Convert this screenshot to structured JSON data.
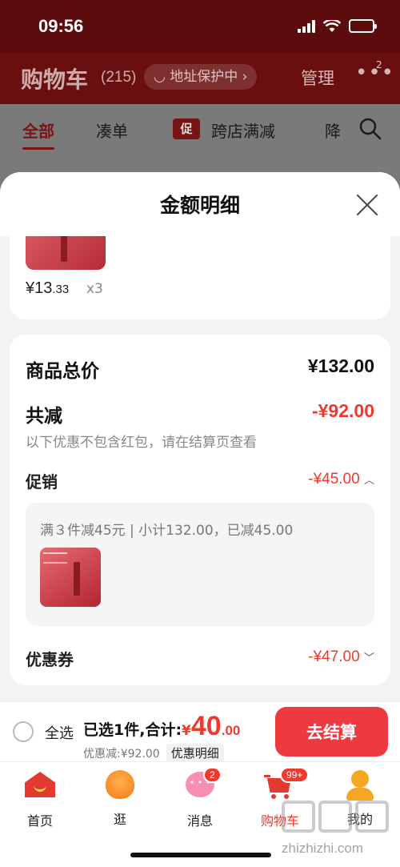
{
  "status": {
    "time": "09:56"
  },
  "header": {
    "title": "购物车",
    "count": "(215)",
    "address_protect": "地址保护中",
    "manage": "管理",
    "more_badge": "2"
  },
  "filters": {
    "all": "全部",
    "bundle": "凑单",
    "promo_tag": "促",
    "cross_store": "跨店满减",
    "cut_off": "降"
  },
  "sheet": {
    "title": "金额明细",
    "item_price_main": "¥13",
    "item_price_decimal": ".33",
    "item_qty": "x3",
    "total_label": "商品总价",
    "total_value": "¥132.00",
    "reduce_label": "共减",
    "reduce_value": "-¥92.00",
    "reduce_note": "以下优惠不包含红包，请在结算页查看",
    "promo_label": "促销",
    "promo_value": "-¥45.00",
    "promo_detail": "满３件减45元 | 小计132.00，已减45.00",
    "coupon_label": "优惠券",
    "coupon_value": "-¥47.00"
  },
  "checkout": {
    "select_all": "全选",
    "selected_text": "已选1件,合计:",
    "currency": "¥",
    "amount_int": "40",
    "amount_dec": ".00",
    "discount_text": "优惠减:¥92.00",
    "detail_tag": "优惠明细",
    "pay_button": "去结算"
  },
  "tabs": [
    {
      "label": "首页",
      "icon": "home-icon"
    },
    {
      "label": "逛",
      "icon": "browse-icon"
    },
    {
      "label": "消息",
      "icon": "message-icon",
      "badge": "2"
    },
    {
      "label": "购物车",
      "icon": "cart-icon",
      "badge": "99+"
    },
    {
      "label": "我的",
      "icon": "profile-icon"
    }
  ],
  "watermark": {
    "text": "zhizhizhi.com"
  },
  "colors": {
    "accent_red": "#ee3a2c",
    "button_red": "#ee3a3f",
    "header_dark": "#6a0f0f"
  }
}
